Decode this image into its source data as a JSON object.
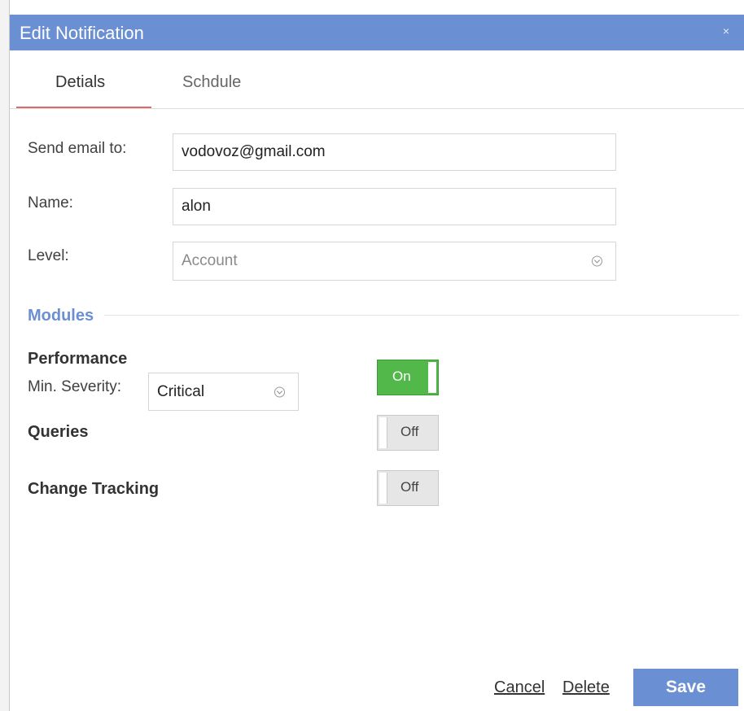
{
  "dialog": {
    "title": "Edit Notification",
    "close_icon": "×"
  },
  "tabs": [
    {
      "label": "Detials",
      "active": true
    },
    {
      "label": "Schdule",
      "active": false
    }
  ],
  "form": {
    "email_label": "Send email to:",
    "email_value": "vodovoz@gmail.com",
    "name_label": "Name:",
    "name_value": "alon",
    "level_label": "Level:",
    "level_value": "Account"
  },
  "modules": {
    "title": "Modules",
    "items": [
      {
        "name": "Performance",
        "severity_label": "Min. Severity:",
        "severity_value": "Critical",
        "toggle_label": "On",
        "enabled": true
      },
      {
        "name": "Queries",
        "toggle_label": "Off",
        "enabled": false
      },
      {
        "name": "Change Tracking",
        "toggle_label": "Off",
        "enabled": false
      }
    ]
  },
  "footer": {
    "cancel_label": "Cancel",
    "delete_label": "Delete",
    "save_label": "Save"
  },
  "colors": {
    "accent": "#6a8fd2",
    "toggle_on": "#52b84a",
    "tab_underline": "#e06a6a"
  }
}
